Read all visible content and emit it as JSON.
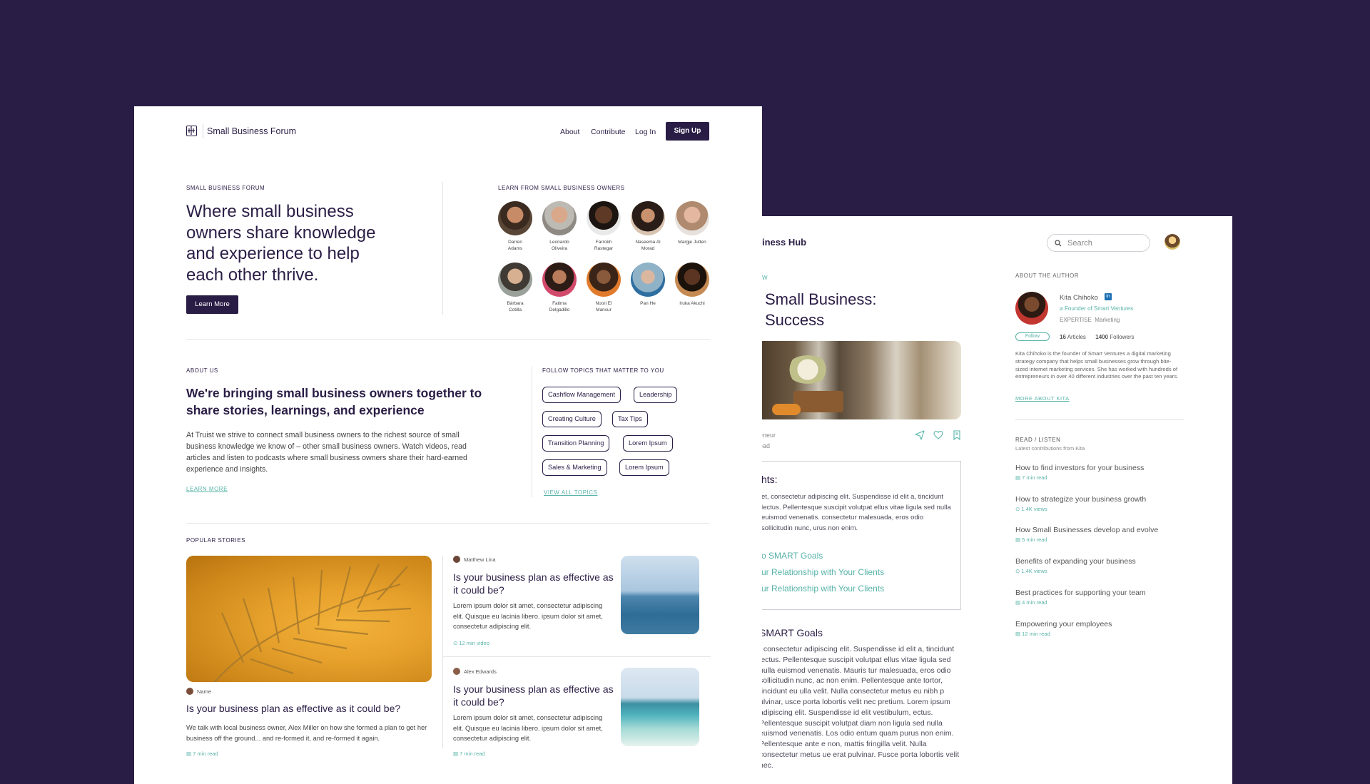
{
  "colors": {
    "background": "#2a1d45",
    "accent": "#57b3a8",
    "primary": "#2a1d45"
  },
  "article_panel": {
    "brand": "iness Hub",
    "search_placeholder": "Search",
    "eyebrow": "W",
    "title_line1": "Small Business:",
    "title_line2": "Success",
    "meta_line1": "eneur",
    "meta_line2": "ead",
    "toc": {
      "heading": "hts:",
      "body": "et, consectetur adipiscing elit. Suspendisse id elit a, tincidunt lectus. Pellentesque suscipit volutpat ellus vitae ligula sed nulla euismod venenatis. consectetur malesuada, eros odio sollicitudin nunc, urus non enim.",
      "links": [
        "o SMART Goals",
        "ur Relationship with Your Clients",
        "ur Relationship with Your Clients"
      ]
    },
    "section_heading": "SMART Goals",
    "section_body": ", consectetur adipiscing elit. Suspendisse id elit a, tincidunt lectus. Pellentesque suscipit volutpat ellus vitae ligula sed nulla euismod venenatis. Mauris tur malesuada, eros odio sollicitudin nunc, ac non enim. Pellentesque ante tortor, tincidunt eu ulla velit. Nulla consectetur metus eu nibh p ulvinar, usce porta lobortis velit nec pretium. Lorem ipsum adipiscing elit. Suspendisse id elit vestibulum, ectus. Pellentesque suscipit volutpat diam non ligula sed nulla euismod venenatis. Los odio entum quam purus non enim. Pellentesque ante e non, mattis fringilla velit. Nulla consectetur metus ue erat pulvinar. Fusce porta lobortis velit nec.",
    "author": {
      "label": "ABOUT THE AUTHOR",
      "name": "Kita Chihoko",
      "linkedin": "in",
      "role": "Founder of Smart Ventures",
      "expertise_label": "EXPERTISE",
      "expertise": "Marketing",
      "follow": "Follow",
      "articles_count": "16",
      "articles_label": "Articles",
      "followers_count": "1400",
      "followers_label": "Followers",
      "bio": "Kita Chihoko is the founder of Smart Ventures a digital marketing strategy company that helps small businesses grow through bite-sized internet marketing services. She has worked with hundreds of entrepreneurs in over 40 different industries over the past ten years.",
      "more_link": "MORE ABOUT KITA"
    },
    "read_listen": {
      "label": "READ / LISTEN",
      "subtitle": "Latest contributions from Kita",
      "items": [
        {
          "title": "How to find investors for your business",
          "meta": "7 min read"
        },
        {
          "title": "How to strategize your business growth",
          "meta": "1.4K views"
        },
        {
          "title": "How Small Businesses develop and evolve",
          "meta": "5 min read"
        },
        {
          "title": "Benefits of expanding your business",
          "meta": "1.4K views"
        },
        {
          "title": "Best practices for supporting your team",
          "meta": "4 min read"
        },
        {
          "title": "Empowering your employees",
          "meta": "12 min read"
        }
      ]
    }
  },
  "forum_panel": {
    "brand": "Small Business Forum",
    "nav": [
      "About",
      "Contribute",
      "Log In"
    ],
    "signup": "Sign Up",
    "hero": {
      "eyebrow": "SMALL BUSINESS FORUM",
      "title": "Where small business owners share knowledge and experience to help each other thrive.",
      "button": "Learn More"
    },
    "owners": {
      "label": "LEARN FROM SMALL BUSINESS OWNERS",
      "people": [
        {
          "name_l1": "Darren",
          "name_l2": "Adams"
        },
        {
          "name_l1": "Leonardo",
          "name_l2": "Oliveira"
        },
        {
          "name_l1": "Farrokh",
          "name_l2": "Rastegar"
        },
        {
          "name_l1": "Naseema Al",
          "name_l2": "Morad"
        },
        {
          "name_l1": "Margje Jutten",
          "name_l2": ""
        },
        {
          "name_l1": "Bárbara",
          "name_l2": "Cotilla"
        },
        {
          "name_l1": "Fatima",
          "name_l2": "Delgadillo"
        },
        {
          "name_l1": "Noori El",
          "name_l2": "Mansur"
        },
        {
          "name_l1": "Pan He",
          "name_l2": ""
        },
        {
          "name_l1": "Iruka Akuchi",
          "name_l2": ""
        }
      ]
    },
    "about": {
      "eyebrow": "ABOUT US",
      "title": "We're bringing small business owners together to share stories, learnings, and experience",
      "body": "At Truist we strive to connect small business owners to the richest source of small business knowledge we know of – other small business owners. Watch videos, read articles and listen to podcasts where small business owners share their hard-earned experience and insights.",
      "link": "LEARN MORE"
    },
    "topics": {
      "label": "FOLLOW TOPICS THAT MATTER TO YOU",
      "items": [
        "Cashflow Management",
        "Leadership",
        "Creating Culture",
        "Tax Tips",
        "Transition Planning",
        "Lorem Ipsum",
        "Sales & Marketing",
        "Lorem Ipsum"
      ],
      "link": "VIEW ALL TOPICS"
    },
    "popular": {
      "label": "POPULAR STORIES",
      "featured": {
        "author": "Name",
        "title": "Is your business plan as effective as it could be?",
        "body": "We talk with local business owner, Alex Miller on how she formed a plan to get her business off the ground... and re-formed it, and re-formed it again.",
        "meta": "7 min read"
      },
      "stories": [
        {
          "author": "Matthew Lina",
          "title": "Is your business plan as effective as it could be?",
          "body": "Lorem ipsum dolor sit amet, consectetur adipiscing elit. Quisque eu lacinia libero. ipsum dolor sit amet, consectetur adipiscing elit.",
          "meta": "12 min video"
        },
        {
          "author": "Alex Edwards",
          "title": "Is your business plan as effective as it could be?",
          "body": "Lorem ipsum dolor sit amet, consectetur adipiscing elit. Quisque eu lacinia libero. ipsum dolor sit amet, consectetur adipiscing elit.",
          "meta": "7 min read"
        }
      ]
    }
  }
}
